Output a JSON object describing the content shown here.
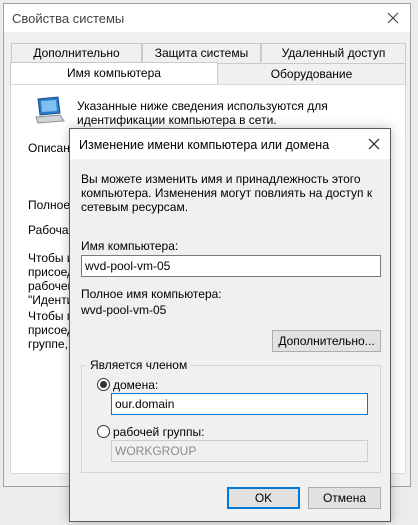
{
  "system_window": {
    "title": "Свойства системы",
    "tabs_row1": [
      "Дополнительно",
      "Защита системы",
      "Удаленный доступ"
    ],
    "tabs_row2": [
      "Имя компьютера",
      "Оборудование"
    ],
    "info_text": "Указанные ниже сведения используются для идентификации компьютера в сети.",
    "partial_labels": [
      "Описани",
      "Полное и",
      "Рабочая",
      "Чтобы ис",
      "присоеди",
      "рабочей",
      "\"Идентис",
      "Чтобы пе",
      "присоеди",
      "группе, н"
    ]
  },
  "dialog": {
    "title": "Изменение имени компьютера или домена",
    "description": "Вы можете изменить имя и принадлежность этого компьютера. Изменения могут повлиять на доступ к сетевым ресурсам.",
    "computer_name_label": "Имя компьютера:",
    "computer_name_value": "wvd-pool-vm-05",
    "full_name_label": "Полное имя компьютера:",
    "full_name_value": "wvd-pool-vm-05",
    "more_button": "Дополнительно...",
    "member_of_label": "Является членом",
    "domain_radio_label": "домена:",
    "domain_value": "our.domain",
    "workgroup_radio_label": "рабочей группы:",
    "workgroup_value": "WORKGROUP",
    "selected_membership": "domain",
    "ok_button": "OK",
    "cancel_button": "Отмена"
  },
  "icons": {
    "computer": "computer-monitor-icon",
    "close": "close-icon"
  },
  "colors": {
    "default_button_border": "#0078d7",
    "window_bg": "#f0f0f0"
  }
}
